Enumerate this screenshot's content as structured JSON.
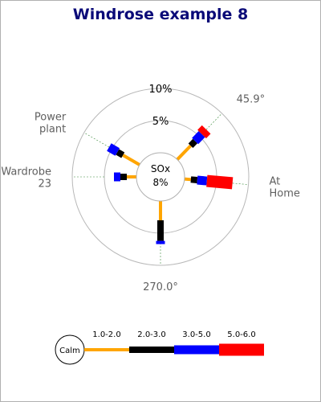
{
  "chart_data": {
    "type": "windrose",
    "title": "Windrose example 8",
    "center_label": "SOx",
    "center_value": "8%",
    "range_max_percent": 10,
    "ring_labels": [
      "5%",
      "10%"
    ],
    "ring_values": [
      5,
      10
    ],
    "direction_labels": [
      {
        "text": "45.9°",
        "angle": 45.9
      },
      {
        "text": "270.0°",
        "angle": 270
      },
      {
        "text": "Power plant",
        "angle": 150
      },
      {
        "text": "Wardrobe 23",
        "angle": 180
      },
      {
        "text": "At Home",
        "angle": 355
      }
    ],
    "legend": {
      "calm_label": "Calm",
      "ranges": [
        "1.0-2.0",
        "2.0-3.0",
        "3.0-5.0",
        "5.0-6.0"
      ],
      "colors": [
        "#ffa500",
        "#000000",
        "#0000ff",
        "#ff0000"
      ]
    },
    "series": [
      {
        "angle": 45.9,
        "values": [
          3,
          1,
          1.5,
          1
        ]
      },
      {
        "angle": 150,
        "values": [
          3,
          1,
          1.5,
          0
        ]
      },
      {
        "angle": 180,
        "values": [
          1.5,
          1,
          1,
          0
        ]
      },
      {
        "angle": 270,
        "values": [
          3,
          3.2,
          0.5,
          0
        ]
      },
      {
        "angle": 355,
        "values": [
          1,
          1,
          1.5,
          4
        ]
      }
    ]
  }
}
